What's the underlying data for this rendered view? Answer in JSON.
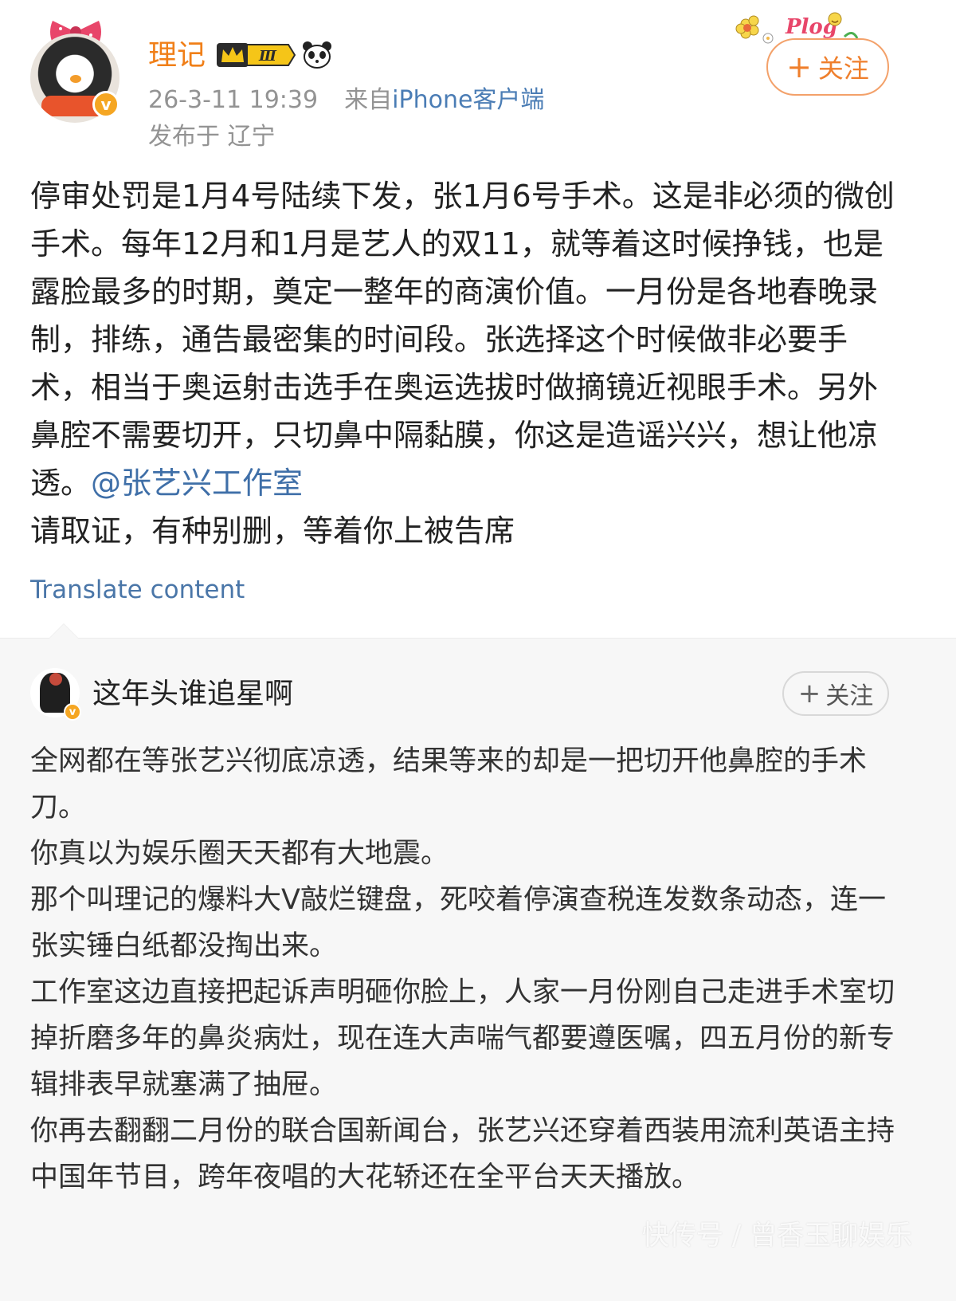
{
  "post": {
    "username": "理记",
    "level_badge": "Ⅲ",
    "timestamp": "26-3-11 19:39",
    "source_prefix": "来自",
    "source": "iPhone客户端",
    "location_label": "发布于",
    "location": "辽宁",
    "follow_label": "关注",
    "body_parts": {
      "text_before_mention": "停审处罚是1月4号陆续下发，张1月6号手术。这是非必须的微创手术。每年12月和1月是艺人的双11，就等着这时候挣钱，也是露脸最多的时期，奠定一整年的商演价值。一月份是各地春晚录制，排练，通告最密集的时间段。张选择这个时候做非必要手术，相当于奥运射击选手在奥运选拔时做摘镜近视眼手术。另外鼻腔不需要切开，只切鼻中隔黏膜，你这是造谣兴兴，想让他凉透。",
      "mention": "@张艺兴工作室",
      "text_after_mention": "请取证，有种别删，等着你上被告席"
    },
    "translate_label": "Translate content",
    "sticker_text": "Plog"
  },
  "repost": {
    "username": "这年头谁追星啊",
    "follow_label": "关注",
    "paragraphs": [
      "全网都在等张艺兴彻底凉透，结果等来的却是一把切开他鼻腔的手术刀。",
      "你真以为娱乐圈天天都有大地震。",
      "那个叫理记的爆料大V敲烂键盘，死咬着停演查税连发数条动态，连一张实锤白纸都没掏出来。",
      "工作室这边直接把起诉声明砸你脸上，人家一月份刚自己走进手术室切掉折磨多年的鼻炎病灶，现在连大声喘气都要遵医嘱，四五月份的新专辑排表早就塞满了抽屉。",
      "你再去翻翻二月份的联合国新闻台，张艺兴还穿着西装用流利英语主持中国年节目，跨年夜唱的大花轿还在全平台天天播放。"
    ]
  },
  "watermark": "快传号 / 曾香玉聊娱乐",
  "colors": {
    "username": "#f07f18",
    "link": "#3f6fa8",
    "follow_border": "#f3a16a",
    "meta": "#939393",
    "repost_bg": "#f7f7f7"
  }
}
